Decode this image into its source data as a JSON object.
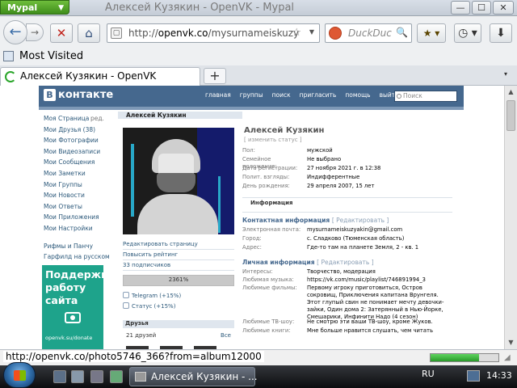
{
  "browser": {
    "app_name": "Mypal",
    "app_menu_arrow": "▼",
    "window_title": "Алексей Кузякин - OpenVK - Mypal",
    "controls": {
      "minimize": "—",
      "maximize": "☐",
      "close": "✕"
    },
    "nav": {
      "back": "←",
      "forward": "→",
      "stop": "✕",
      "home": "⌂",
      "url_prefix": "http://",
      "url_host": "openvk.co",
      "url_path": "/mysurnameiskuzy",
      "star": "☆",
      "dropdown": "▼",
      "search_placeholder": "DuckDuc",
      "search_go": "🔍",
      "bookmarks_btn": "★ ▾",
      "history_btn": "◷ ▾",
      "downloads_btn": "⬇"
    },
    "bookmarks_bar": {
      "most_visited": "Most Visited"
    },
    "tab": {
      "title": "Алексей Кузякин - OpenVK",
      "new_tab": "+",
      "list": "▾"
    },
    "status_url": "http://openvk.co/photo5746_366?from=album12000",
    "download_progress": 0.72
  },
  "vk": {
    "logo_letter": "В",
    "logo_text": "контакте",
    "nav": [
      "главная",
      "группы",
      "поиск",
      "пригласить",
      "помощь",
      "выйти"
    ],
    "search_placeholder": "Поиск",
    "left_menu": [
      "Моя Страница",
      "Мои Друзья (38)",
      "Мои Фотографии",
      "Мои Видеозаписи",
      "Мои Сообщения",
      "Мои Заметки",
      "Мои Группы",
      "Мои Новости",
      "Мои Ответы",
      "Мои Приложения",
      "Мои Настройки"
    ],
    "left_edit": "ред.",
    "left_extra": [
      "Рифмы и Панчу",
      "Гарфилд на русском"
    ],
    "ad": {
      "text_lines": [
        "Поддержи",
        "работу",
        "сайта"
      ],
      "url": "openvk.su/donate"
    },
    "name_tab": "Алексей Кузякин",
    "actions": [
      "Редактировать страницу",
      "Повысить рейтинг",
      "33 подписчиков"
    ],
    "rating": {
      "label": "2361%",
      "fill": 1.0
    },
    "links": [
      "Telegram (+15%)",
      "Статус (+15%)"
    ],
    "friends": {
      "title": "Друзья",
      "count": "21 друзей",
      "all": "Все"
    },
    "profile": {
      "name": "Алексей Кузякин",
      "status": "[ изменить статус ]",
      "basic": [
        {
          "k": "Пол:",
          "v": "мужской"
        },
        {
          "k": "Семейное положение:",
          "v": "Не выбрано"
        },
        {
          "k": "Дата регистрации:",
          "v": "27 ноября 2021 г. в 12:38"
        },
        {
          "k": "Полит. взгляды:",
          "v": "Индифферентные"
        },
        {
          "k": "День рождения:",
          "v": "29 апреля 2007, 15 лет"
        }
      ],
      "info_header": "Информация",
      "contact_title": "Контактная информация",
      "contact_edit": "[ Редактировать ]",
      "contact": [
        {
          "k": "Электронная почта:",
          "v": "mysurnameiskuzyakin@gmail.com"
        },
        {
          "k": "Город:",
          "v": "с. Сладково (Тюменская область)"
        },
        {
          "k": "Адрес:",
          "v": "Где-то там на планете Земля, 2 - кв. 1"
        }
      ],
      "personal_title": "Личная информация",
      "personal_edit": "[ Редактировать ]",
      "personal": [
        {
          "k": "Интересы:",
          "v": "Творчество, модерация"
        },
        {
          "k": "Любимая музыка:",
          "v": "https://vk.com/music/playlist/746891994_3"
        },
        {
          "k": "Любимые фильмы:",
          "v": "Первому игроку приготовиться, Остров сокровищ, Приключения капитана Врунгеля. Этот глупый свин не понимает мечту девочки-зайки, Один дома 2: Затерянный в Нью-Йорке, Смешарики, Инфинити Надо (4 сезон)"
        },
        {
          "k": "Любимые ТВ-шоу:",
          "v": "Не смотрю эти ваши ТВ-шоу, кроме Жуков."
        },
        {
          "k": "Любимые книги:",
          "v": "Мне больше нравится слушать, чем читать"
        }
      ]
    }
  },
  "taskbar": {
    "task_label": "Алексей Кузякин - ...",
    "lang": "RU",
    "clock": "14:33"
  }
}
